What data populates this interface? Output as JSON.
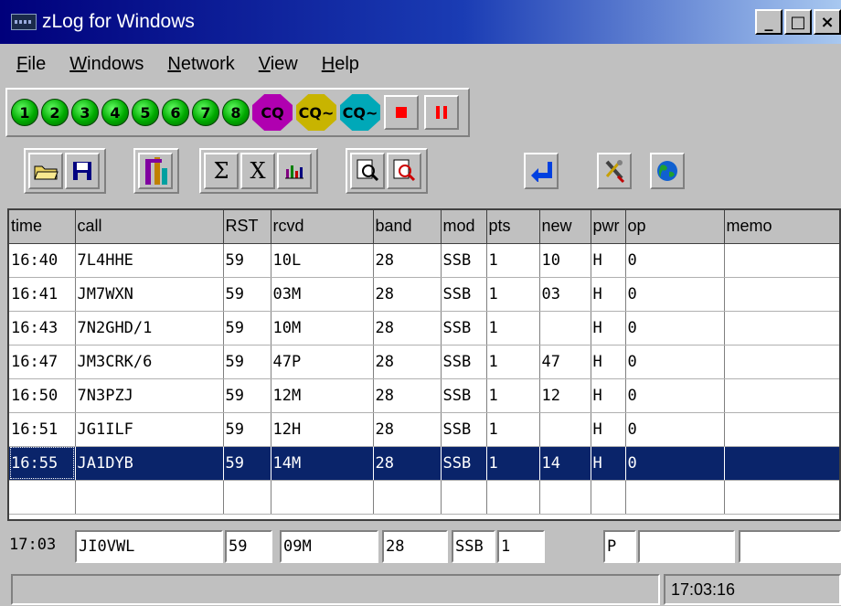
{
  "window": {
    "title": "zLog for Windows",
    "buttons": [
      "_",
      "□",
      "×"
    ]
  },
  "menu": [
    "File",
    "Windows",
    "Network",
    "View",
    "Help"
  ],
  "toolbar1": {
    "numbers": [
      "1",
      "2",
      "3",
      "4",
      "5",
      "6",
      "7",
      "8"
    ],
    "cq_buttons": [
      "CQ",
      "CQ~",
      "CQ~"
    ],
    "colors": {
      "green": "#00aa00",
      "cq1": "#b000b0",
      "cq2": "#c8b400",
      "cq3": "#00a8b8",
      "stop": "#ff0000"
    }
  },
  "toolbar2": {
    "icons": [
      "open-folder-icon",
      "save-disk-icon",
      "partial-check-icon",
      "sigma-icon",
      "x-icon",
      "bar-chart-icon",
      "zoom-in-icon",
      "zoom-out-icon",
      "return-arrow-icon",
      "tools-icon",
      "globe-icon"
    ],
    "sigma": "Σ",
    "x": "X"
  },
  "log": {
    "columns": [
      "time",
      "call",
      "RST",
      "rcvd",
      "band",
      "mod",
      "pts",
      "new",
      "pwr",
      "op",
      "memo"
    ],
    "rows": [
      [
        "16:40",
        "7L4HHE",
        "59",
        "10L",
        "28",
        "SSB",
        "1",
        "10",
        "H",
        "0",
        ""
      ],
      [
        "16:41",
        "JM7WXN",
        "59",
        "03M",
        "28",
        "SSB",
        "1",
        "03",
        "H",
        "0",
        ""
      ],
      [
        "16:43",
        "7N2GHD/1",
        "59",
        "10M",
        "28",
        "SSB",
        "1",
        "",
        "H",
        "0",
        ""
      ],
      [
        "16:47",
        "JM3CRK/6",
        "59",
        "47P",
        "28",
        "SSB",
        "1",
        "47",
        "H",
        "0",
        ""
      ],
      [
        "16:50",
        "7N3PZJ",
        "59",
        "12M",
        "28",
        "SSB",
        "1",
        "12",
        "H",
        "0",
        ""
      ],
      [
        "16:51",
        "JG1ILF",
        "59",
        "12H",
        "28",
        "SSB",
        "1",
        "",
        "H",
        "0",
        ""
      ],
      [
        "16:55",
        "JA1DYB",
        "59",
        "14M",
        "28",
        "SSB",
        "1",
        "14",
        "H",
        "0",
        ""
      ],
      [
        "",
        "",
        "",
        "",
        "",
        "",
        "",
        "",
        "",
        "",
        ""
      ]
    ],
    "selected_row": 6
  },
  "entry": {
    "time": "17:03",
    "call": "JI0VWL",
    "rst": "59",
    "rcvd": "09M",
    "band": "28",
    "mode": "SSB",
    "pts": "1",
    "pwr": "P",
    "op": "",
    "memo": ""
  },
  "status": {
    "message": "",
    "clock": "17:03:16"
  }
}
